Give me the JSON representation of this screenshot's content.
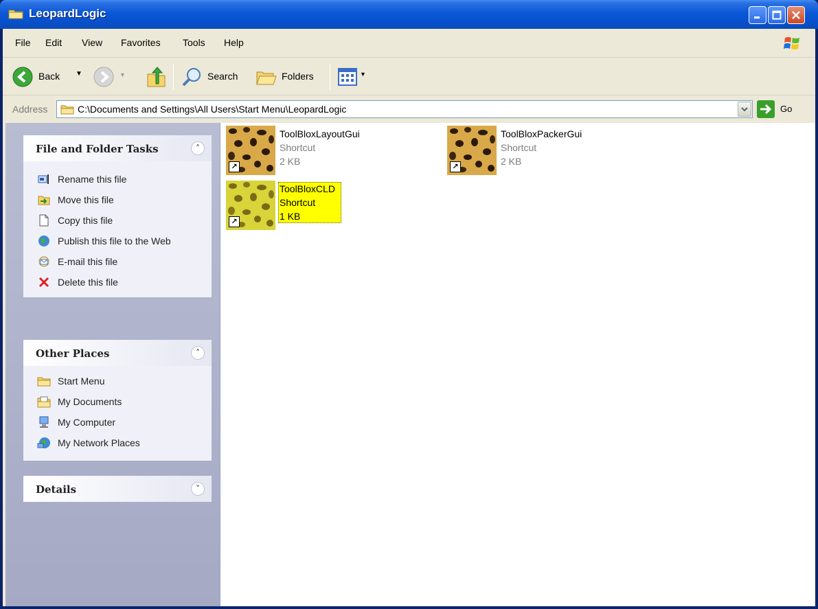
{
  "window": {
    "title": "LeopardLogic"
  },
  "menu": [
    "File",
    "Edit",
    "View",
    "Favorites",
    "Tools",
    "Help"
  ],
  "toolbar": {
    "back_label": "Back",
    "search_label": "Search",
    "folders_label": "Folders"
  },
  "address": {
    "label": "Address",
    "path": "C:\\Documents and Settings\\All Users\\Start Menu\\LeopardLogic",
    "go_label": "Go"
  },
  "panels": {
    "tasks": {
      "title": "File and Folder Tasks",
      "items": [
        {
          "label": "Rename this file",
          "icon": "rename-icon"
        },
        {
          "label": "Move this file",
          "icon": "move-icon"
        },
        {
          "label": "Copy this file",
          "icon": "copy-icon"
        },
        {
          "label": "Publish this file to the Web",
          "icon": "publish-web-icon"
        },
        {
          "label": "E-mail this file",
          "icon": "email-icon"
        },
        {
          "label": "Delete this file",
          "icon": "delete-icon"
        }
      ]
    },
    "places": {
      "title": "Other Places",
      "items": [
        {
          "label": "Start Menu",
          "icon": "folder-icon"
        },
        {
          "label": "My Documents",
          "icon": "my-documents-icon"
        },
        {
          "label": "My Computer",
          "icon": "my-computer-icon"
        },
        {
          "label": "My Network Places",
          "icon": "network-places-icon"
        }
      ]
    },
    "details": {
      "title": "Details"
    }
  },
  "files": [
    {
      "name": "ToolBloxLayoutGui",
      "type": "Shortcut",
      "size": "2 KB",
      "selected": false
    },
    {
      "name": "ToolBloxPackerGui",
      "type": "Shortcut",
      "size": "2 KB",
      "selected": false
    },
    {
      "name": "ToolBloxCLD",
      "type": "Shortcut",
      "size": "1 KB",
      "selected": true
    }
  ],
  "colors": {
    "titlebar": "#0a58d8",
    "task_pane": "#a5a9c4",
    "selection": "#ffff00"
  }
}
